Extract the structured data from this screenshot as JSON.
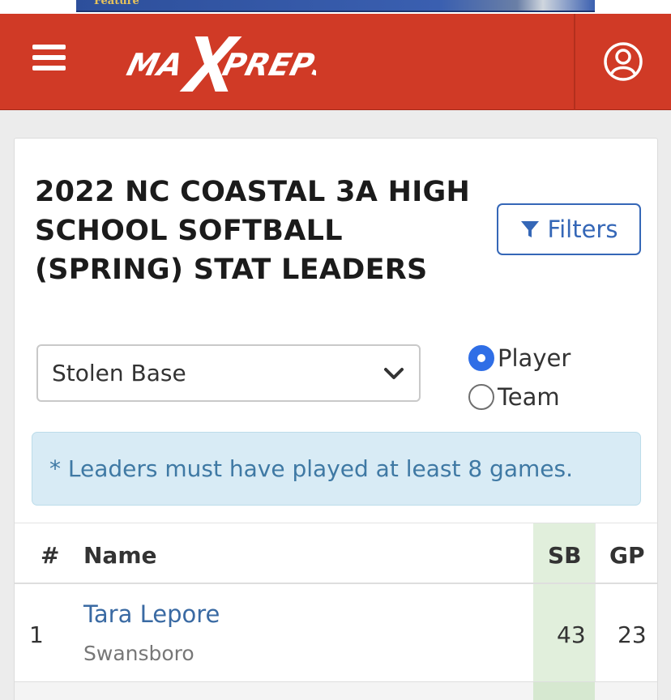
{
  "ad": {
    "text": "Feature"
  },
  "header": {
    "brand": "MAXPREPS",
    "colors": {
      "brand_red": "#d03a26",
      "accent_blue": "#3567b7"
    },
    "icons": {
      "menu": "hamburger-menu-icon",
      "user": "user-account-icon"
    }
  },
  "page": {
    "title": "2022 NC Coastal 3A High School Softball (Spring) Stat Leaders",
    "filters_label": "Filters",
    "stat_select": {
      "selected": "Stolen Base"
    },
    "view_toggle": [
      {
        "label": "Player",
        "checked": true
      },
      {
        "label": "Team",
        "checked": false
      }
    ],
    "note": "* Leaders must have played at least 8 games."
  },
  "table": {
    "headers": {
      "rank": "#",
      "name": "Name",
      "sb": "SB",
      "gp": "GP"
    },
    "rows": [
      {
        "rank": "1",
        "name": "Tara Lepore",
        "school": "Swansboro",
        "sb": "43",
        "gp": "23"
      }
    ]
  }
}
